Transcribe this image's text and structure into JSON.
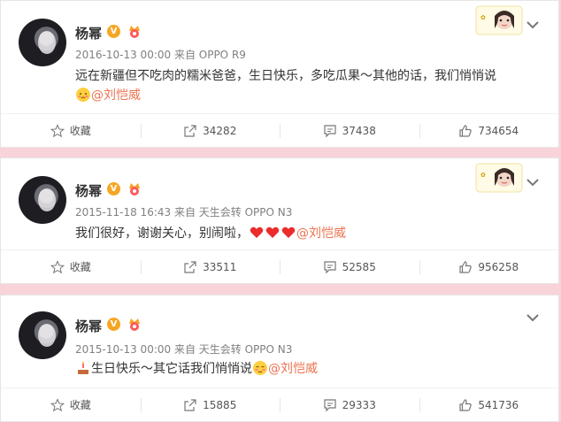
{
  "posts": [
    {
      "author": "杨幂",
      "badge_v": "V",
      "meta": "2016-10-13 00:00 来自 OPPO R9",
      "text_line1": "远在新疆但不吃肉的糯米爸爸，生日快乐，多吃瓜果～其他的话，我们悄悄说",
      "mention": "@刘恺威",
      "actions": {
        "favorite": "收藏",
        "repost": "34282",
        "comment": "37438",
        "like": "734654"
      }
    },
    {
      "author": "杨幂",
      "badge_v": "V",
      "meta": "2015-11-18 16:43 来自 天生会转 OPPO N3",
      "text": "我们很好，谢谢关心，别闹啦，",
      "mention": "@刘恺威",
      "actions": {
        "favorite": "收藏",
        "repost": "33511",
        "comment": "52585",
        "like": "956258"
      }
    },
    {
      "author": "杨幂",
      "badge_v": "V",
      "meta": "2015-10-13 00:00 来自 天生会转 OPPO N3",
      "text": "生日快乐～其它话我们悄悄说",
      "mention": "@刘恺威",
      "actions": {
        "favorite": "收藏",
        "repost": "15885",
        "comment": "29333",
        "like": "541736"
      }
    }
  ],
  "colors": {
    "background": "#f9d3da",
    "mention": "#eb7350",
    "badge": "#f6a623"
  }
}
